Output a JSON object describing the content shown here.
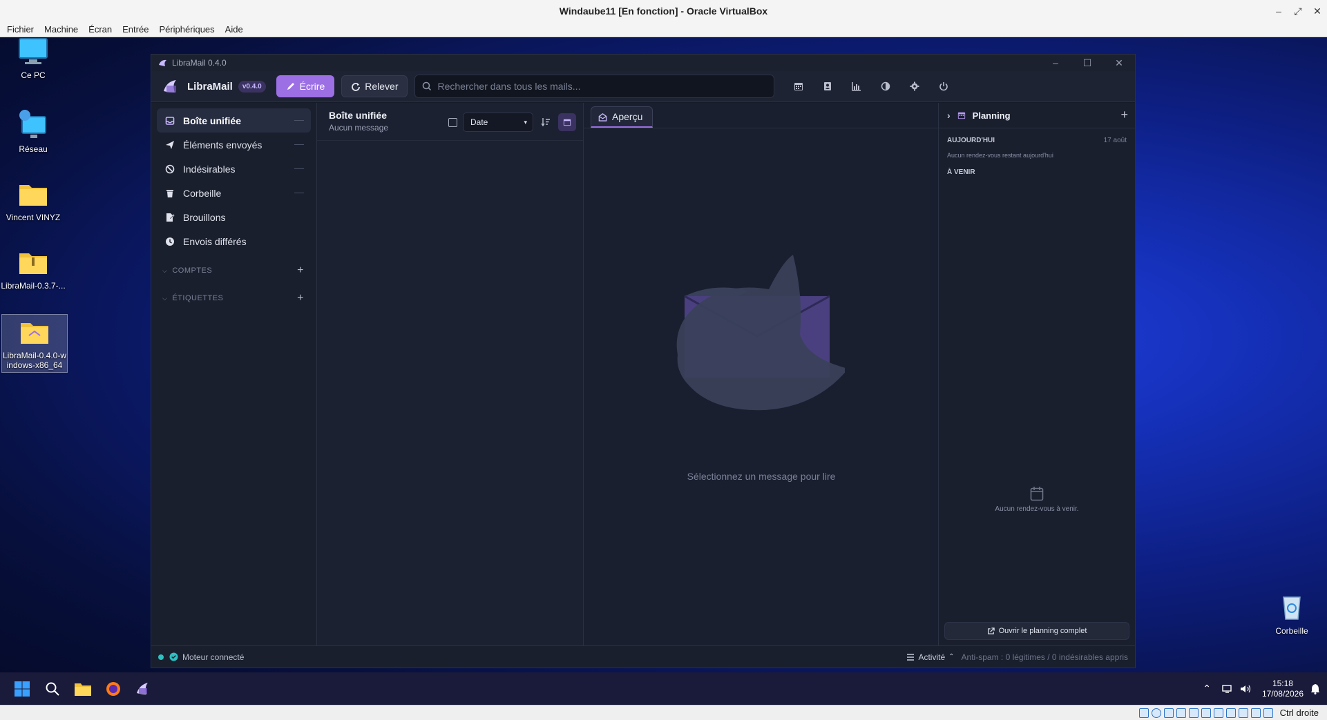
{
  "host": {
    "window_title": "Windaube11 [En fonction] - Oracle VirtualBox",
    "menu": [
      "Fichier",
      "Machine",
      "Écran",
      "Entrée",
      "Périphériques",
      "Aide"
    ],
    "host_key": "Ctrl droite"
  },
  "desktop": {
    "icons": [
      {
        "label": "Ce PC",
        "icon": "monitor-icon"
      },
      {
        "label": "Réseau",
        "icon": "network-icon"
      },
      {
        "label": "Vincent VINYZ",
        "icon": "folder-icon"
      },
      {
        "label": "LibraMail-0.3.7-...",
        "icon": "zip-folder-icon"
      },
      {
        "label": "LibraMail-0.4.0-windows-x86_64",
        "icon": "zip-folder-icon"
      },
      {
        "label": "Corbeille",
        "icon": "recycle-bin-icon"
      }
    ]
  },
  "taskbar": {
    "time": "15:18",
    "date": "17/08/2026"
  },
  "app": {
    "window_title": "LibraMail 0.4.0",
    "brand": "LibraMail",
    "version_badge": "v0.4.0",
    "write_label": "Écrire",
    "fetch_label": "Relever",
    "search_placeholder": "Rechercher dans tous les mails...",
    "toolbar_icons": [
      "calendar-icon",
      "contacts-icon",
      "stats-icon",
      "theme-icon",
      "settings-icon",
      "power-icon"
    ],
    "accent": "#9c6fe4",
    "sidebar": {
      "items": [
        {
          "label": "Boîte unifiée",
          "icon": "inbox-icon",
          "active": true
        },
        {
          "label": "Éléments envoyés",
          "icon": "send-icon"
        },
        {
          "label": "Indésirables",
          "icon": "ban-icon"
        },
        {
          "label": "Corbeille",
          "icon": "trash-icon"
        },
        {
          "label": "Brouillons",
          "icon": "draft-icon"
        },
        {
          "label": "Envois différés",
          "icon": "clock-icon"
        }
      ],
      "accounts_label": "COMPTES",
      "labels_label": "ÉTIQUETTES"
    },
    "list": {
      "title": "Boîte unifiée",
      "subtitle": "Aucun message",
      "sort_value": "Date"
    },
    "preview": {
      "tab_label": "Aperçu",
      "empty_text": "Sélectionnez un message pour lire"
    },
    "planning": {
      "title": "Planning",
      "today_label": "AUJOURD'HUI",
      "today_date": "17 août",
      "today_empty": "Aucun rendez-vous restant aujourd'hui",
      "upcoming_label": "À VENIR",
      "upcoming_empty": "Aucun rendez-vous à venir.",
      "open_full": "Ouvrir le planning complet"
    },
    "status": {
      "engine": "Moteur connecté",
      "activity": "Activité",
      "antispam": "Anti-spam : 0 légitimes / 0 indésirables appris"
    }
  }
}
